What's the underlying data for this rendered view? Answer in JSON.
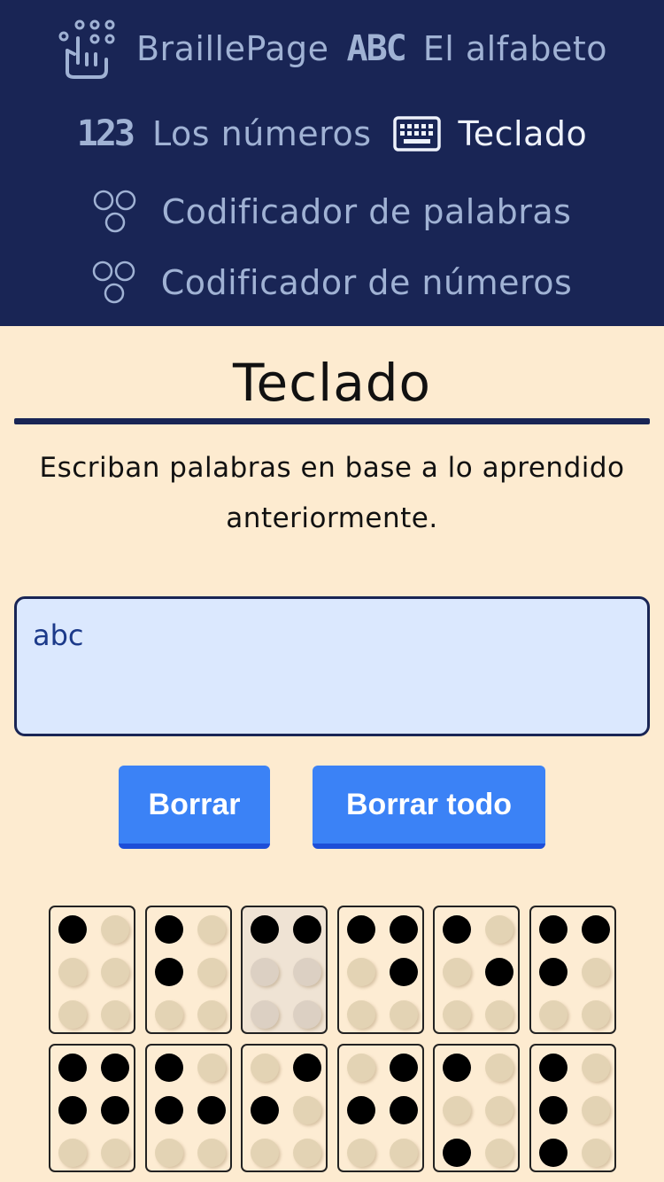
{
  "nav": {
    "brand": "BraillePage",
    "links": [
      {
        "label": "El alfabeto",
        "icon": "abc-icon",
        "glyph": "ABC"
      },
      {
        "label": "Los números",
        "icon": "numbers-icon",
        "glyph": "123"
      },
      {
        "label": "Teclado",
        "icon": "keyboard-icon",
        "active": true
      },
      {
        "label": "Codificador de palabras",
        "icon": "braille-cells-icon"
      },
      {
        "label": "Codificador de números",
        "icon": "braille-cells-icon"
      }
    ]
  },
  "main": {
    "title": "Teclado",
    "description": "Escriban palabras en base a lo aprendido anteriormente.",
    "input_value": "abc",
    "buttons": {
      "delete": "Borrar",
      "delete_all": "Borrar todo"
    }
  },
  "keyboard": {
    "keys": [
      {
        "letter": "a",
        "dots": [
          1
        ]
      },
      {
        "letter": "b",
        "dots": [
          1,
          2
        ]
      },
      {
        "letter": "c",
        "dots": [
          1,
          4
        ],
        "highlighted": true
      },
      {
        "letter": "d",
        "dots": [
          1,
          4,
          5
        ]
      },
      {
        "letter": "e",
        "dots": [
          1,
          5
        ]
      },
      {
        "letter": "f",
        "dots": [
          1,
          2,
          4
        ]
      },
      {
        "letter": "g",
        "dots": [
          1,
          2,
          4,
          5
        ]
      },
      {
        "letter": "h",
        "dots": [
          1,
          2,
          5
        ]
      },
      {
        "letter": "i",
        "dots": [
          2,
          4
        ]
      },
      {
        "letter": "j",
        "dots": [
          2,
          4,
          5
        ]
      },
      {
        "letter": "k",
        "dots": [
          1,
          3
        ]
      },
      {
        "letter": "l",
        "dots": [
          1,
          2,
          3
        ]
      }
    ]
  },
  "colors": {
    "nav_bg": "#192555",
    "page_bg": "#fdebd0",
    "button": "#3b82f6",
    "input_bg": "#dbe8fe"
  }
}
